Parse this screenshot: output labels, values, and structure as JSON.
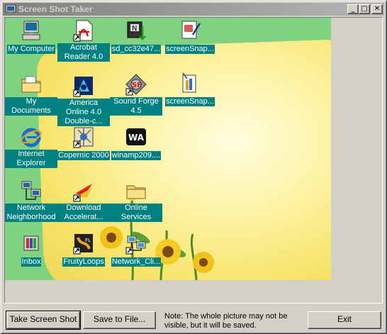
{
  "window": {
    "title": "Screen Shot Taker",
    "controls": {
      "minimize": "_",
      "maximize": "□",
      "close": "✕"
    }
  },
  "desktop": {
    "icons": [
      {
        "label": "My Computer",
        "icon": "computer-icon"
      },
      {
        "label": "Acrobat Reader 4.0",
        "icon": "acrobat-icon"
      },
      {
        "label": "sd_cc32e47...",
        "icon": "installer-icon"
      },
      {
        "label": "screenSnap...",
        "icon": "screensnap-icon"
      },
      {
        "label": "My Documents",
        "icon": "folder-icon"
      },
      {
        "label": "America Online 4.0 Double-c...",
        "icon": "aol-icon"
      },
      {
        "label": "Sound Forge 4.5",
        "icon": "soundforge-icon"
      },
      {
        "label": "screenSnap...",
        "icon": "screensnap-paint-icon"
      },
      {
        "label": "Internet Explorer",
        "icon": "internet-explorer-icon"
      },
      {
        "label": "Copernic 2000",
        "icon": "copernic-icon"
      },
      {
        "label": "winamp209....",
        "icon": "winamp-icon"
      },
      {
        "label": "Network Neighborhood",
        "icon": "network-icon"
      },
      {
        "label": "Download Accelerat...",
        "icon": "download-accelerator-icon"
      },
      {
        "label": "Online Services",
        "icon": "folder-icon"
      },
      {
        "label": "Inbox",
        "icon": "inbox-icon"
      },
      {
        "label": "FruityLoops",
        "icon": "fruityloops-icon"
      },
      {
        "label": "Network_Cli...",
        "icon": "network-client-icon"
      }
    ]
  },
  "footer": {
    "take_label": "Take Screen Shot",
    "save_label": "Save to File...",
    "note": "Note:  The whole picture may not be visible, but it will be saved.",
    "exit_label": "Exit"
  },
  "colors": {
    "label_bg": "#008080",
    "desktop_green": "#7fd27f",
    "wallpaper_yellow": "#fdf3a6",
    "title_gradient": "#808080"
  }
}
